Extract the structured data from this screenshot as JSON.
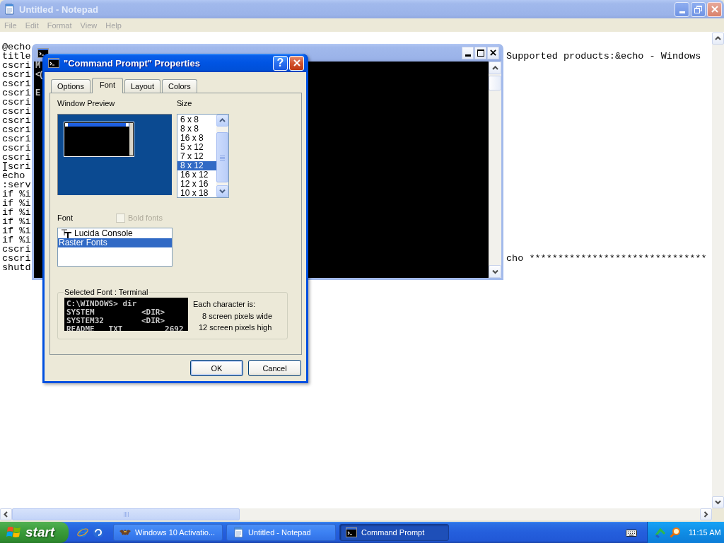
{
  "notepad": {
    "title": "Untitled - Notepad",
    "active": false,
    "menu": [
      "File",
      "Edit",
      "Format",
      "View",
      "Help"
    ],
    "lines": [
      {
        "start": "@echo",
        "pointer": false
      },
      {
        "start": "title",
        "end": "Supported products:&echo - Windows",
        "pointer": false
      },
      {
        "start": "cscri",
        "pointer": false
      },
      {
        "start": "cscri",
        "pointer": false
      },
      {
        "start": "cscri",
        "pointer": false
      },
      {
        "start": "cscri",
        "pointer": false
      },
      {
        "start": "cscri",
        "pointer": false
      },
      {
        "start": "cscri",
        "pointer": false
      },
      {
        "start": "cscri",
        "pointer": false
      },
      {
        "start": "cscri",
        "pointer": false
      },
      {
        "start": "cscri",
        "pointer": false
      },
      {
        "start": "cscri",
        "pointer": false
      },
      {
        "start": "cscri",
        "pointer": false
      },
      {
        "start": "scri",
        "pointer": true
      },
      {
        "start": "echo",
        "pointer": false
      },
      {
        "start": ":serv",
        "pointer": false
      },
      {
        "start": "if %i",
        "pointer": false
      },
      {
        "start": "if %i",
        "pointer": false
      },
      {
        "start": "if %i",
        "pointer": false
      },
      {
        "start": "if %i",
        "pointer": false
      },
      {
        "start": "if %i",
        "pointer": false
      },
      {
        "start": "if %i",
        "pointer": false
      },
      {
        "start": "cscri",
        "pointer": false
      },
      {
        "start": "cscri",
        "end": "cho *******************************",
        "pointer": false
      },
      {
        "start": "shutd",
        "pointer": false
      }
    ]
  },
  "command_prompt": {
    "active": false,
    "console_paragraphs": [
      {
        "lines": [
          "M",
          "<("
        ]
      },
      {
        "lines": [
          "E"
        ]
      }
    ]
  },
  "dialog": {
    "title": "\"Command Prompt\" Properties",
    "active": true,
    "help_button": "?",
    "tabs": [
      {
        "label": "Options",
        "selected": false
      },
      {
        "label": "Font",
        "selected": true
      },
      {
        "label": "Layout",
        "selected": false
      },
      {
        "label": "Colors",
        "selected": false
      }
    ],
    "window_preview_label": "Window Preview",
    "size_label": "Size",
    "sizes": [
      {
        "label": "6 x 8",
        "selected": false
      },
      {
        "label": "8 x 8",
        "selected": false
      },
      {
        "label": "16 x 8",
        "selected": false
      },
      {
        "label": "5 x 12",
        "selected": false
      },
      {
        "label": "7 x 12",
        "selected": false
      },
      {
        "label": "8 x 12",
        "selected": true
      },
      {
        "label": "16 x 12",
        "selected": false
      },
      {
        "label": "12 x 16",
        "selected": false
      },
      {
        "label": "10 x 18",
        "selected": false
      }
    ],
    "font_label": "Font",
    "bold_fonts": {
      "label": "Bold fonts",
      "checked": false,
      "disabled": true
    },
    "fonts": [
      {
        "label": "Lucida Console",
        "kind": "truetype",
        "selected": false
      },
      {
        "label": "Raster Fonts",
        "kind": "raster",
        "selected": true
      }
    ],
    "selected_font": {
      "title": "Selected Font : Terminal",
      "preview_lines": [
        "C:\\WINDOWS> dir",
        "SYSTEM          <DIR>",
        "SYSTEM32        <DIR>",
        "README   TXT         2692"
      ],
      "info_title": "Each character is:",
      "info_lines": [
        "8 screen pixels wide",
        "12 screen pixels high"
      ]
    },
    "buttons": [
      {
        "label": "OK",
        "default": true
      },
      {
        "label": "Cancel",
        "default": false
      }
    ]
  },
  "taskbar": {
    "start": "start",
    "tasks": [
      {
        "label": "Windows 10 Activatio...",
        "kind": "app",
        "selected": false
      },
      {
        "label": "Untitled - Notepad",
        "kind": "notepad",
        "selected": false
      },
      {
        "label": "Command Prompt",
        "kind": "console",
        "selected": true
      }
    ],
    "clock": "11:15 AM"
  }
}
